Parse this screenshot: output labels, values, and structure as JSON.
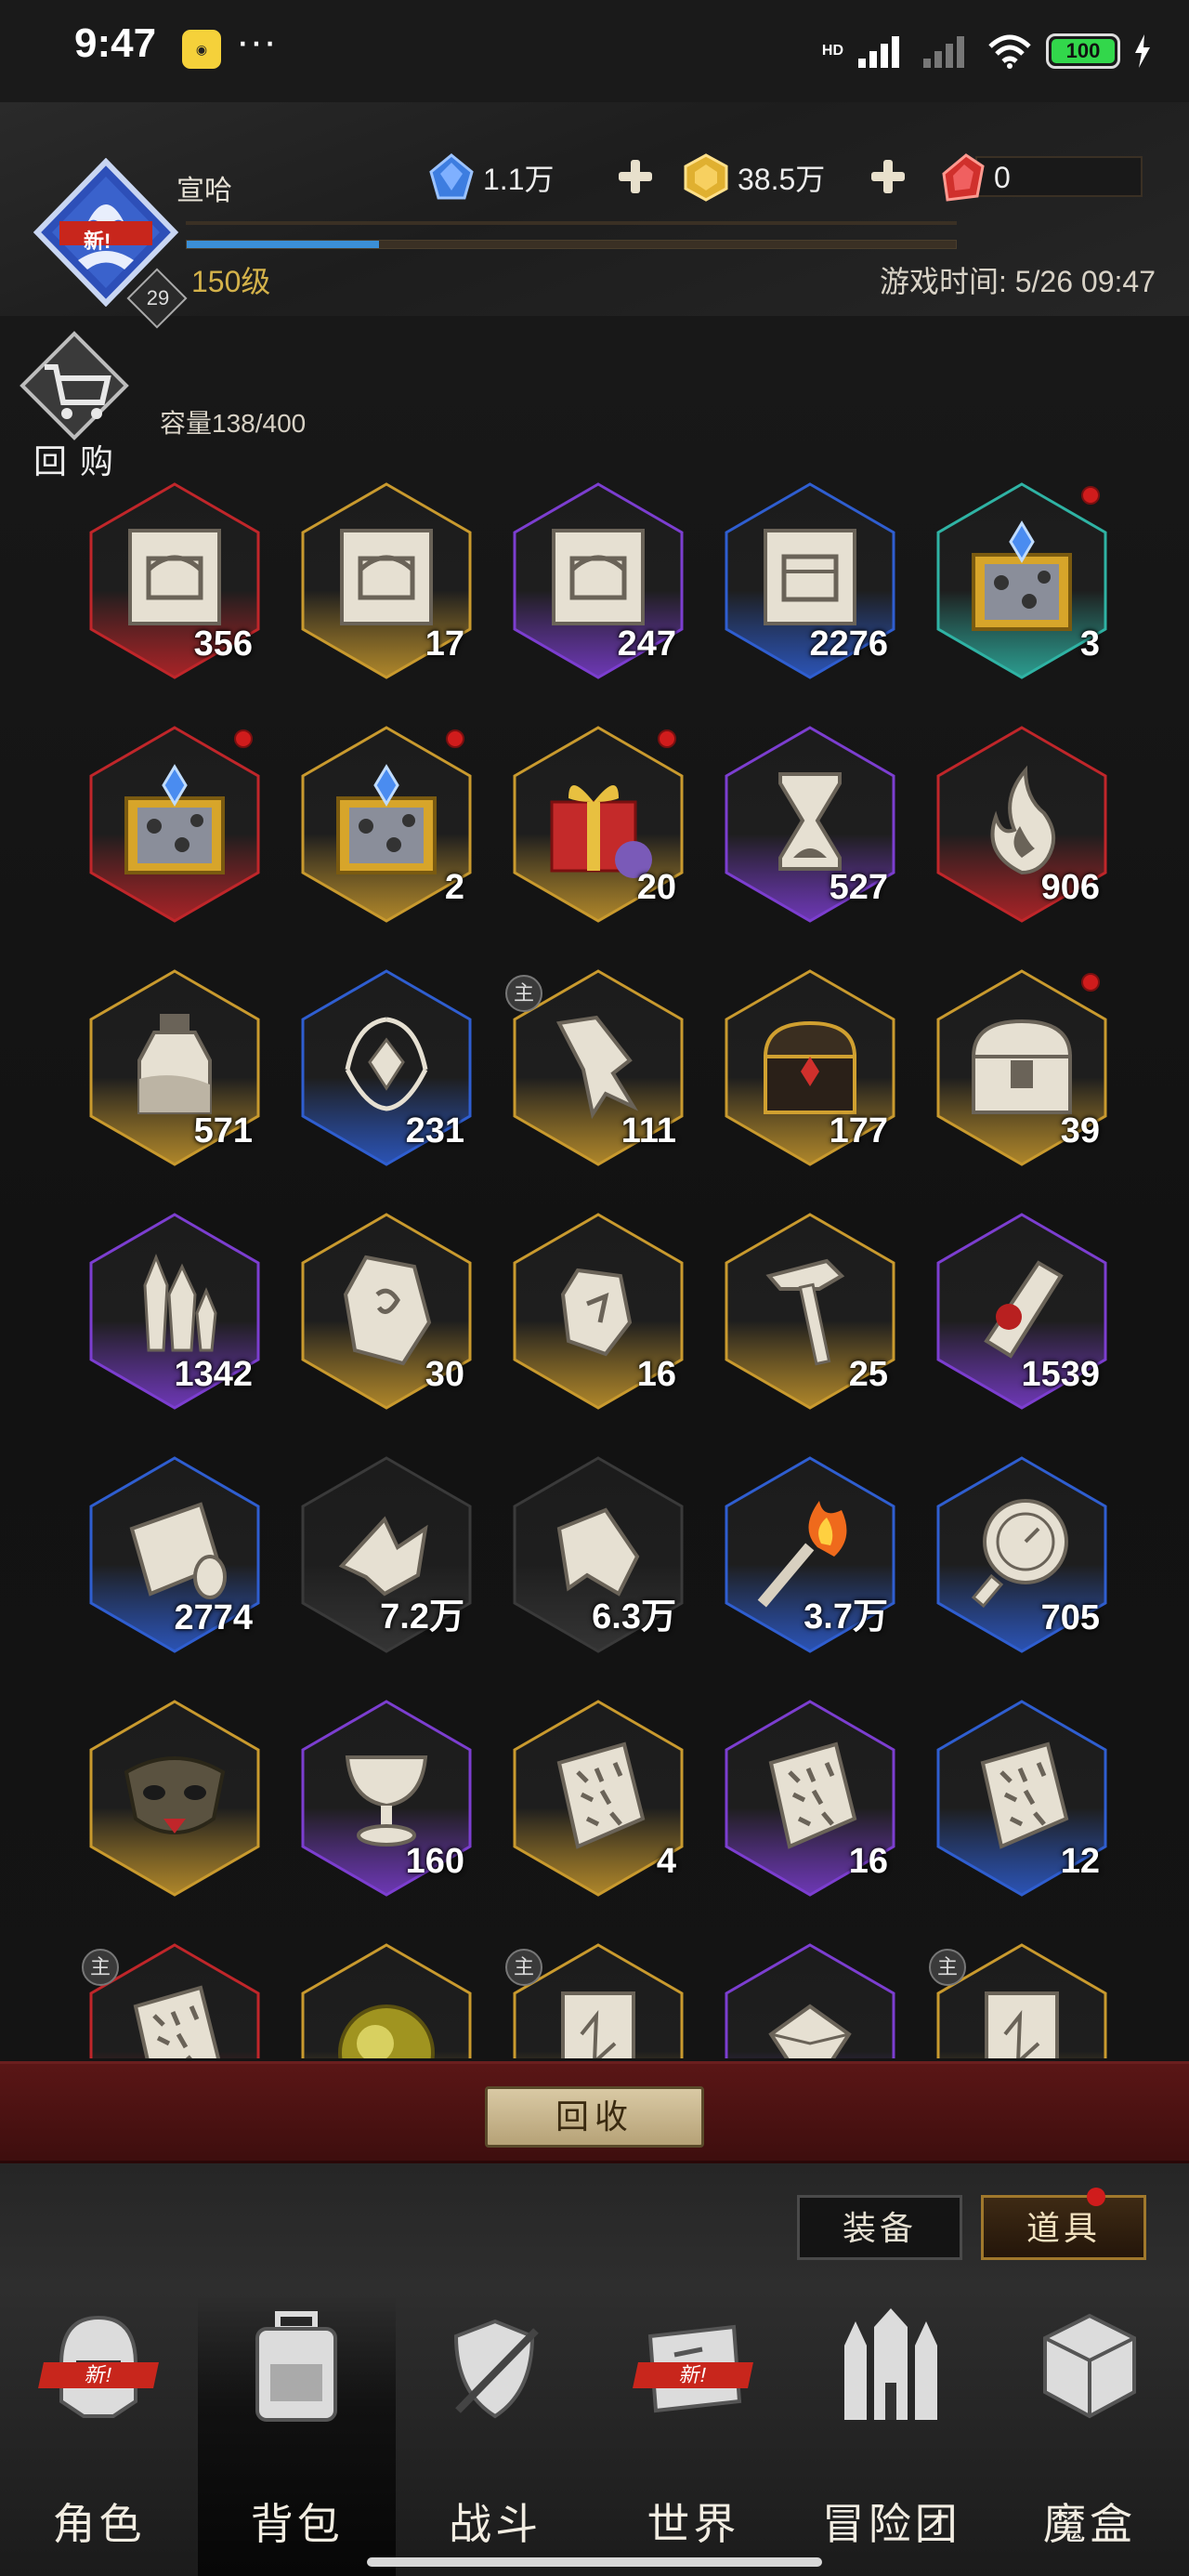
{
  "status_bar": {
    "time": "9:47",
    "app_icon": "app-notification-icon",
    "dots": "···",
    "network": "HD",
    "battery": "100"
  },
  "header": {
    "player_name": "宣哈",
    "level": "150级",
    "badge": "29",
    "new_tag": "新!",
    "currency": [
      {
        "icon": "blue-gem-icon",
        "value": "1.1万",
        "color": "#3d7de0"
      },
      {
        "icon": "gold-gem-icon",
        "value": "38.5万",
        "color": "#e0b030"
      },
      {
        "icon": "red-gem-icon",
        "value": "0",
        "color": "#d0302c"
      }
    ],
    "playtime": "游戏时间: 5/26 09:47",
    "xp_fraction": 0.25
  },
  "buyback": {
    "label": "回购",
    "icon": "cart-icon"
  },
  "capacity": "容量138/400",
  "items": [
    {
      "icon": "blueprint-chest-scroll-icon",
      "count": "356",
      "rarity": "red",
      "dot": false,
      "main": false
    },
    {
      "icon": "blueprint-chest-scroll-icon",
      "count": "17",
      "rarity": "gold",
      "dot": false,
      "main": false
    },
    {
      "icon": "blueprint-chest-scroll-icon",
      "count": "247",
      "rarity": "purple",
      "dot": false,
      "main": false
    },
    {
      "icon": "blueprint-crate-scroll-icon",
      "count": "2276",
      "rarity": "blue",
      "dot": false,
      "main": false
    },
    {
      "icon": "mystery-box-icon",
      "count": "3",
      "rarity": "teal",
      "dot": true,
      "main": false
    },
    {
      "icon": "mystery-box-icon",
      "count": "",
      "rarity": "red",
      "dot": true,
      "main": false
    },
    {
      "icon": "mystery-box-icon",
      "count": "2",
      "rarity": "gold",
      "dot": true,
      "main": false
    },
    {
      "icon": "gift-box-icon",
      "count": "20",
      "rarity": "gold",
      "dot": true,
      "main": false
    },
    {
      "icon": "hourglass-icon",
      "count": "527",
      "rarity": "purple",
      "dot": false,
      "main": false
    },
    {
      "icon": "flame-icon",
      "count": "906",
      "rarity": "red",
      "dot": false,
      "main": false
    },
    {
      "icon": "potion-jar-icon",
      "count": "571",
      "rarity": "gold",
      "dot": false,
      "main": false
    },
    {
      "icon": "laurel-crystal-icon",
      "count": "231",
      "rarity": "blue",
      "dot": false,
      "main": false
    },
    {
      "icon": "crystal-shard-icon",
      "count": "111",
      "rarity": "gold",
      "dot": false,
      "main": true
    },
    {
      "icon": "treasure-chest-icon",
      "count": "177",
      "rarity": "gold",
      "dot": false,
      "main": false
    },
    {
      "icon": "locked-chest-icon",
      "count": "39",
      "rarity": "gold",
      "dot": true,
      "main": false
    },
    {
      "icon": "crystal-cluster-icon",
      "count": "1342",
      "rarity": "purple",
      "dot": false,
      "main": false
    },
    {
      "icon": "rune-stone-icon",
      "count": "30",
      "rarity": "gold",
      "dot": false,
      "main": false
    },
    {
      "icon": "rune-pebble-icon",
      "count": "16",
      "rarity": "gold",
      "dot": false,
      "main": false
    },
    {
      "icon": "hammer-icon",
      "count": "25",
      "rarity": "gold",
      "dot": false,
      "main": false
    },
    {
      "icon": "sealed-scroll-icon",
      "count": "1539",
      "rarity": "purple",
      "dot": false,
      "main": false
    },
    {
      "icon": "scroll-icon",
      "count": "2774",
      "rarity": "blue",
      "dot": false,
      "main": false
    },
    {
      "icon": "torn-scroll-icon",
      "count": "7.2万",
      "rarity": "none",
      "dot": false,
      "main": false
    },
    {
      "icon": "paper-scrap-icon",
      "count": "6.3万",
      "rarity": "none",
      "dot": false,
      "main": false
    },
    {
      "icon": "torch-icon",
      "count": "3.7万",
      "rarity": "blue",
      "dot": false,
      "main": false
    },
    {
      "icon": "pocket-watch-icon",
      "count": "705",
      "rarity": "blue",
      "dot": false,
      "main": false
    },
    {
      "icon": "mask-icon",
      "count": "",
      "rarity": "gold",
      "dot": false,
      "main": false
    },
    {
      "icon": "goblet-icon",
      "count": "160",
      "rarity": "purple",
      "dot": false,
      "main": false
    },
    {
      "icon": "rune-tablet-icon",
      "count": "4",
      "rarity": "gold",
      "dot": false,
      "main": false
    },
    {
      "icon": "rune-tablet-icon",
      "count": "16",
      "rarity": "purple",
      "dot": false,
      "main": false
    },
    {
      "icon": "rune-tablet-icon",
      "count": "12",
      "rarity": "blue",
      "dot": false,
      "main": false
    },
    {
      "icon": "rune-tablet-icon",
      "count": "",
      "rarity": "red",
      "dot": false,
      "main": true
    },
    {
      "icon": "amber-orb-icon",
      "count": "",
      "rarity": "gold",
      "dot": false,
      "main": false
    },
    {
      "icon": "card-icon",
      "count": "",
      "rarity": "gold",
      "dot": false,
      "main": true
    },
    {
      "icon": "gem-icon",
      "count": "",
      "rarity": "purple",
      "dot": false,
      "main": false
    },
    {
      "icon": "card-icon",
      "count": "",
      "rarity": "gold",
      "dot": false,
      "main": true
    }
  ],
  "main_tag": "主",
  "recycle_label": "回收",
  "tabs": {
    "equipment": "装备",
    "items": "道具"
  },
  "nav": [
    {
      "label": "角色",
      "icon": "helmet-icon",
      "new": true
    },
    {
      "label": "背包",
      "icon": "backpack-icon",
      "new": false
    },
    {
      "label": "战斗",
      "icon": "shield-sword-icon",
      "new": false
    },
    {
      "label": "世界",
      "icon": "map-scroll-icon",
      "new": true
    },
    {
      "label": "冒险团",
      "icon": "castle-icon",
      "new": false
    },
    {
      "label": "魔盒",
      "icon": "magic-cube-icon",
      "new": false
    }
  ],
  "nav_new_tag": "新!",
  "rarity_colors": {
    "red": "#c0262a",
    "gold": "#c99a2e",
    "purple": "#7c3ed0",
    "blue": "#2f5ed0",
    "teal": "#2fb3a4",
    "none": "#3a3a3a"
  }
}
